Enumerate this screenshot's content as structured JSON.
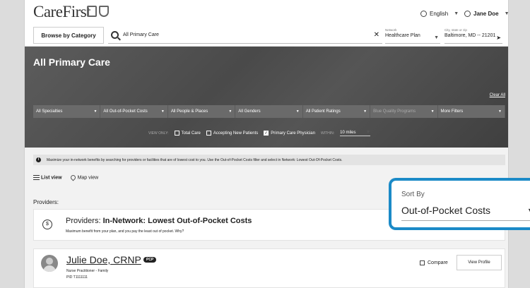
{
  "header": {
    "logo_text": "CareFirst",
    "language": "English",
    "user": "Jane Doe"
  },
  "search": {
    "browse_label": "Browse by Category",
    "query": "All Primary Care",
    "network_label": "Network",
    "network_value": "Healthcare Plan",
    "location_label": "City, state or zip",
    "location_value": "Baltimore, MD -- 21201"
  },
  "hero": {
    "title": "All Primary Care",
    "clear_all": "Clear All",
    "filters": [
      "All Specialties",
      "All Out-of-Pocket Costs",
      "All People & Places",
      "All Genders",
      "All Patient Ratings",
      "Blue Quality Programs",
      "More Filters"
    ],
    "view_only": "VIEW ONLY:",
    "checkboxes": [
      {
        "label": "Total Care",
        "checked": false
      },
      {
        "label": "Accepting New Patients",
        "checked": false
      },
      {
        "label": "Primary Care Physician",
        "checked": true
      }
    ],
    "within_label": "WITHIN:",
    "within_value": "10 miles"
  },
  "banner": {
    "text": "Maximize your in-network benefits by searching for providers or facilities that are of lowest cost to you. Use the Out-of-Pocket Costs filter and select in Network: Lowest Out-Of-Pocket Costs."
  },
  "views": {
    "list": "List view",
    "map": "Map view"
  },
  "providers_label": "Providers:",
  "card1": {
    "title_prefix": "Providers: ",
    "title_bold": "In-Network: Lowest Out-of-Pocket Costs",
    "subtitle": "Maximum benefit from your plan, and you pay the least out of pocket. Why?"
  },
  "provider": {
    "name": "Julie Doe, CRNP",
    "badge": "PCP",
    "specialty": "Nurse Practitioner - Family",
    "pid": "PID T1111111",
    "compare": "Compare",
    "view_profile": "View Profile"
  },
  "sort": {
    "label": "Sort By",
    "value": "Out-of-Pocket Costs"
  },
  "colors": {
    "accent": "#1b8ac7"
  }
}
